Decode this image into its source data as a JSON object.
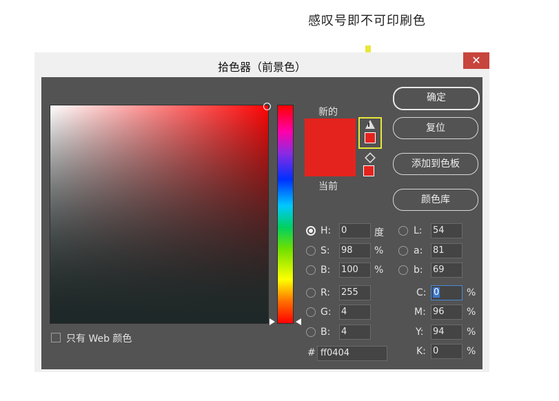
{
  "annotation": {
    "text": "感叹号即不可印刷色"
  },
  "dialog": {
    "title": "拾色器（前景色）",
    "close": "✕"
  },
  "swatches": {
    "new_label": "新的",
    "current_label": "当前"
  },
  "buttons": {
    "ok": "确定",
    "reset": "复位",
    "add_swatch": "添加到色板",
    "libraries": "颜色库"
  },
  "web_only": {
    "label": "只有 Web 颜色"
  },
  "hsb": [
    {
      "label": "H:",
      "value": "0",
      "unit": "度"
    },
    {
      "label": "S:",
      "value": "98",
      "unit": "%"
    },
    {
      "label": "B:",
      "value": "100",
      "unit": "%"
    }
  ],
  "rgb": [
    {
      "label": "R:",
      "value": "255"
    },
    {
      "label": "G:",
      "value": "4"
    },
    {
      "label": "B:",
      "value": "4"
    }
  ],
  "lab": [
    {
      "label": "L:",
      "value": "54"
    },
    {
      "label": "a:",
      "value": "81"
    },
    {
      "label": "b:",
      "value": "69"
    }
  ],
  "cmyk": [
    {
      "label": "C:",
      "value": "0",
      "unit": "%"
    },
    {
      "label": "M:",
      "value": "96",
      "unit": "%"
    },
    {
      "label": "Y:",
      "value": "94",
      "unit": "%"
    },
    {
      "label": "K:",
      "value": "0",
      "unit": "%"
    }
  ],
  "hex": {
    "hash": "#",
    "value": "ff0404"
  },
  "colors": {
    "selected": "#e5231e",
    "highlight": "#e8e83a",
    "dialog_bg": "#535353"
  }
}
